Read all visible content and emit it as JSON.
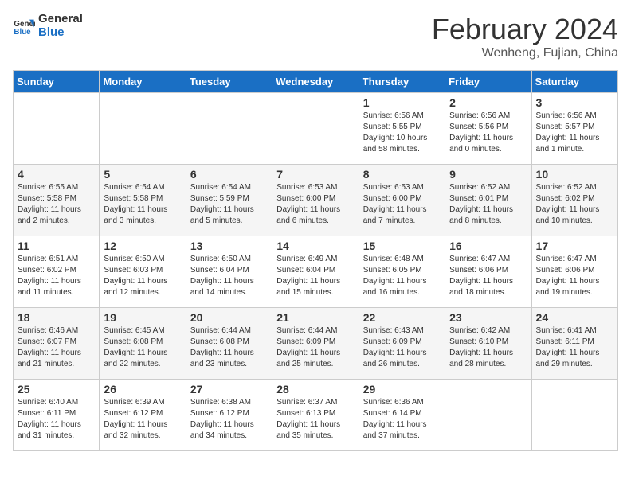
{
  "logo": {
    "line1": "General",
    "line2": "Blue"
  },
  "title": "February 2024",
  "subtitle": "Wenheng, Fujian, China",
  "days_of_week": [
    "Sunday",
    "Monday",
    "Tuesday",
    "Wednesday",
    "Thursday",
    "Friday",
    "Saturday"
  ],
  "weeks": [
    [
      {
        "day": "",
        "info": ""
      },
      {
        "day": "",
        "info": ""
      },
      {
        "day": "",
        "info": ""
      },
      {
        "day": "",
        "info": ""
      },
      {
        "day": "1",
        "info": "Sunrise: 6:56 AM\nSunset: 5:55 PM\nDaylight: 10 hours and 58 minutes."
      },
      {
        "day": "2",
        "info": "Sunrise: 6:56 AM\nSunset: 5:56 PM\nDaylight: 11 hours and 0 minutes."
      },
      {
        "day": "3",
        "info": "Sunrise: 6:56 AM\nSunset: 5:57 PM\nDaylight: 11 hours and 1 minute."
      }
    ],
    [
      {
        "day": "4",
        "info": "Sunrise: 6:55 AM\nSunset: 5:58 PM\nDaylight: 11 hours and 2 minutes."
      },
      {
        "day": "5",
        "info": "Sunrise: 6:54 AM\nSunset: 5:58 PM\nDaylight: 11 hours and 3 minutes."
      },
      {
        "day": "6",
        "info": "Sunrise: 6:54 AM\nSunset: 5:59 PM\nDaylight: 11 hours and 5 minutes."
      },
      {
        "day": "7",
        "info": "Sunrise: 6:53 AM\nSunset: 6:00 PM\nDaylight: 11 hours and 6 minutes."
      },
      {
        "day": "8",
        "info": "Sunrise: 6:53 AM\nSunset: 6:00 PM\nDaylight: 11 hours and 7 minutes."
      },
      {
        "day": "9",
        "info": "Sunrise: 6:52 AM\nSunset: 6:01 PM\nDaylight: 11 hours and 8 minutes."
      },
      {
        "day": "10",
        "info": "Sunrise: 6:52 AM\nSunset: 6:02 PM\nDaylight: 11 hours and 10 minutes."
      }
    ],
    [
      {
        "day": "11",
        "info": "Sunrise: 6:51 AM\nSunset: 6:02 PM\nDaylight: 11 hours and 11 minutes."
      },
      {
        "day": "12",
        "info": "Sunrise: 6:50 AM\nSunset: 6:03 PM\nDaylight: 11 hours and 12 minutes."
      },
      {
        "day": "13",
        "info": "Sunrise: 6:50 AM\nSunset: 6:04 PM\nDaylight: 11 hours and 14 minutes."
      },
      {
        "day": "14",
        "info": "Sunrise: 6:49 AM\nSunset: 6:04 PM\nDaylight: 11 hours and 15 minutes."
      },
      {
        "day": "15",
        "info": "Sunrise: 6:48 AM\nSunset: 6:05 PM\nDaylight: 11 hours and 16 minutes."
      },
      {
        "day": "16",
        "info": "Sunrise: 6:47 AM\nSunset: 6:06 PM\nDaylight: 11 hours and 18 minutes."
      },
      {
        "day": "17",
        "info": "Sunrise: 6:47 AM\nSunset: 6:06 PM\nDaylight: 11 hours and 19 minutes."
      }
    ],
    [
      {
        "day": "18",
        "info": "Sunrise: 6:46 AM\nSunset: 6:07 PM\nDaylight: 11 hours and 21 minutes."
      },
      {
        "day": "19",
        "info": "Sunrise: 6:45 AM\nSunset: 6:08 PM\nDaylight: 11 hours and 22 minutes."
      },
      {
        "day": "20",
        "info": "Sunrise: 6:44 AM\nSunset: 6:08 PM\nDaylight: 11 hours and 23 minutes."
      },
      {
        "day": "21",
        "info": "Sunrise: 6:44 AM\nSunset: 6:09 PM\nDaylight: 11 hours and 25 minutes."
      },
      {
        "day": "22",
        "info": "Sunrise: 6:43 AM\nSunset: 6:09 PM\nDaylight: 11 hours and 26 minutes."
      },
      {
        "day": "23",
        "info": "Sunrise: 6:42 AM\nSunset: 6:10 PM\nDaylight: 11 hours and 28 minutes."
      },
      {
        "day": "24",
        "info": "Sunrise: 6:41 AM\nSunset: 6:11 PM\nDaylight: 11 hours and 29 minutes."
      }
    ],
    [
      {
        "day": "25",
        "info": "Sunrise: 6:40 AM\nSunset: 6:11 PM\nDaylight: 11 hours and 31 minutes."
      },
      {
        "day": "26",
        "info": "Sunrise: 6:39 AM\nSunset: 6:12 PM\nDaylight: 11 hours and 32 minutes."
      },
      {
        "day": "27",
        "info": "Sunrise: 6:38 AM\nSunset: 6:12 PM\nDaylight: 11 hours and 34 minutes."
      },
      {
        "day": "28",
        "info": "Sunrise: 6:37 AM\nSunset: 6:13 PM\nDaylight: 11 hours and 35 minutes."
      },
      {
        "day": "29",
        "info": "Sunrise: 6:36 AM\nSunset: 6:14 PM\nDaylight: 11 hours and 37 minutes."
      },
      {
        "day": "",
        "info": ""
      },
      {
        "day": "",
        "info": ""
      }
    ]
  ]
}
